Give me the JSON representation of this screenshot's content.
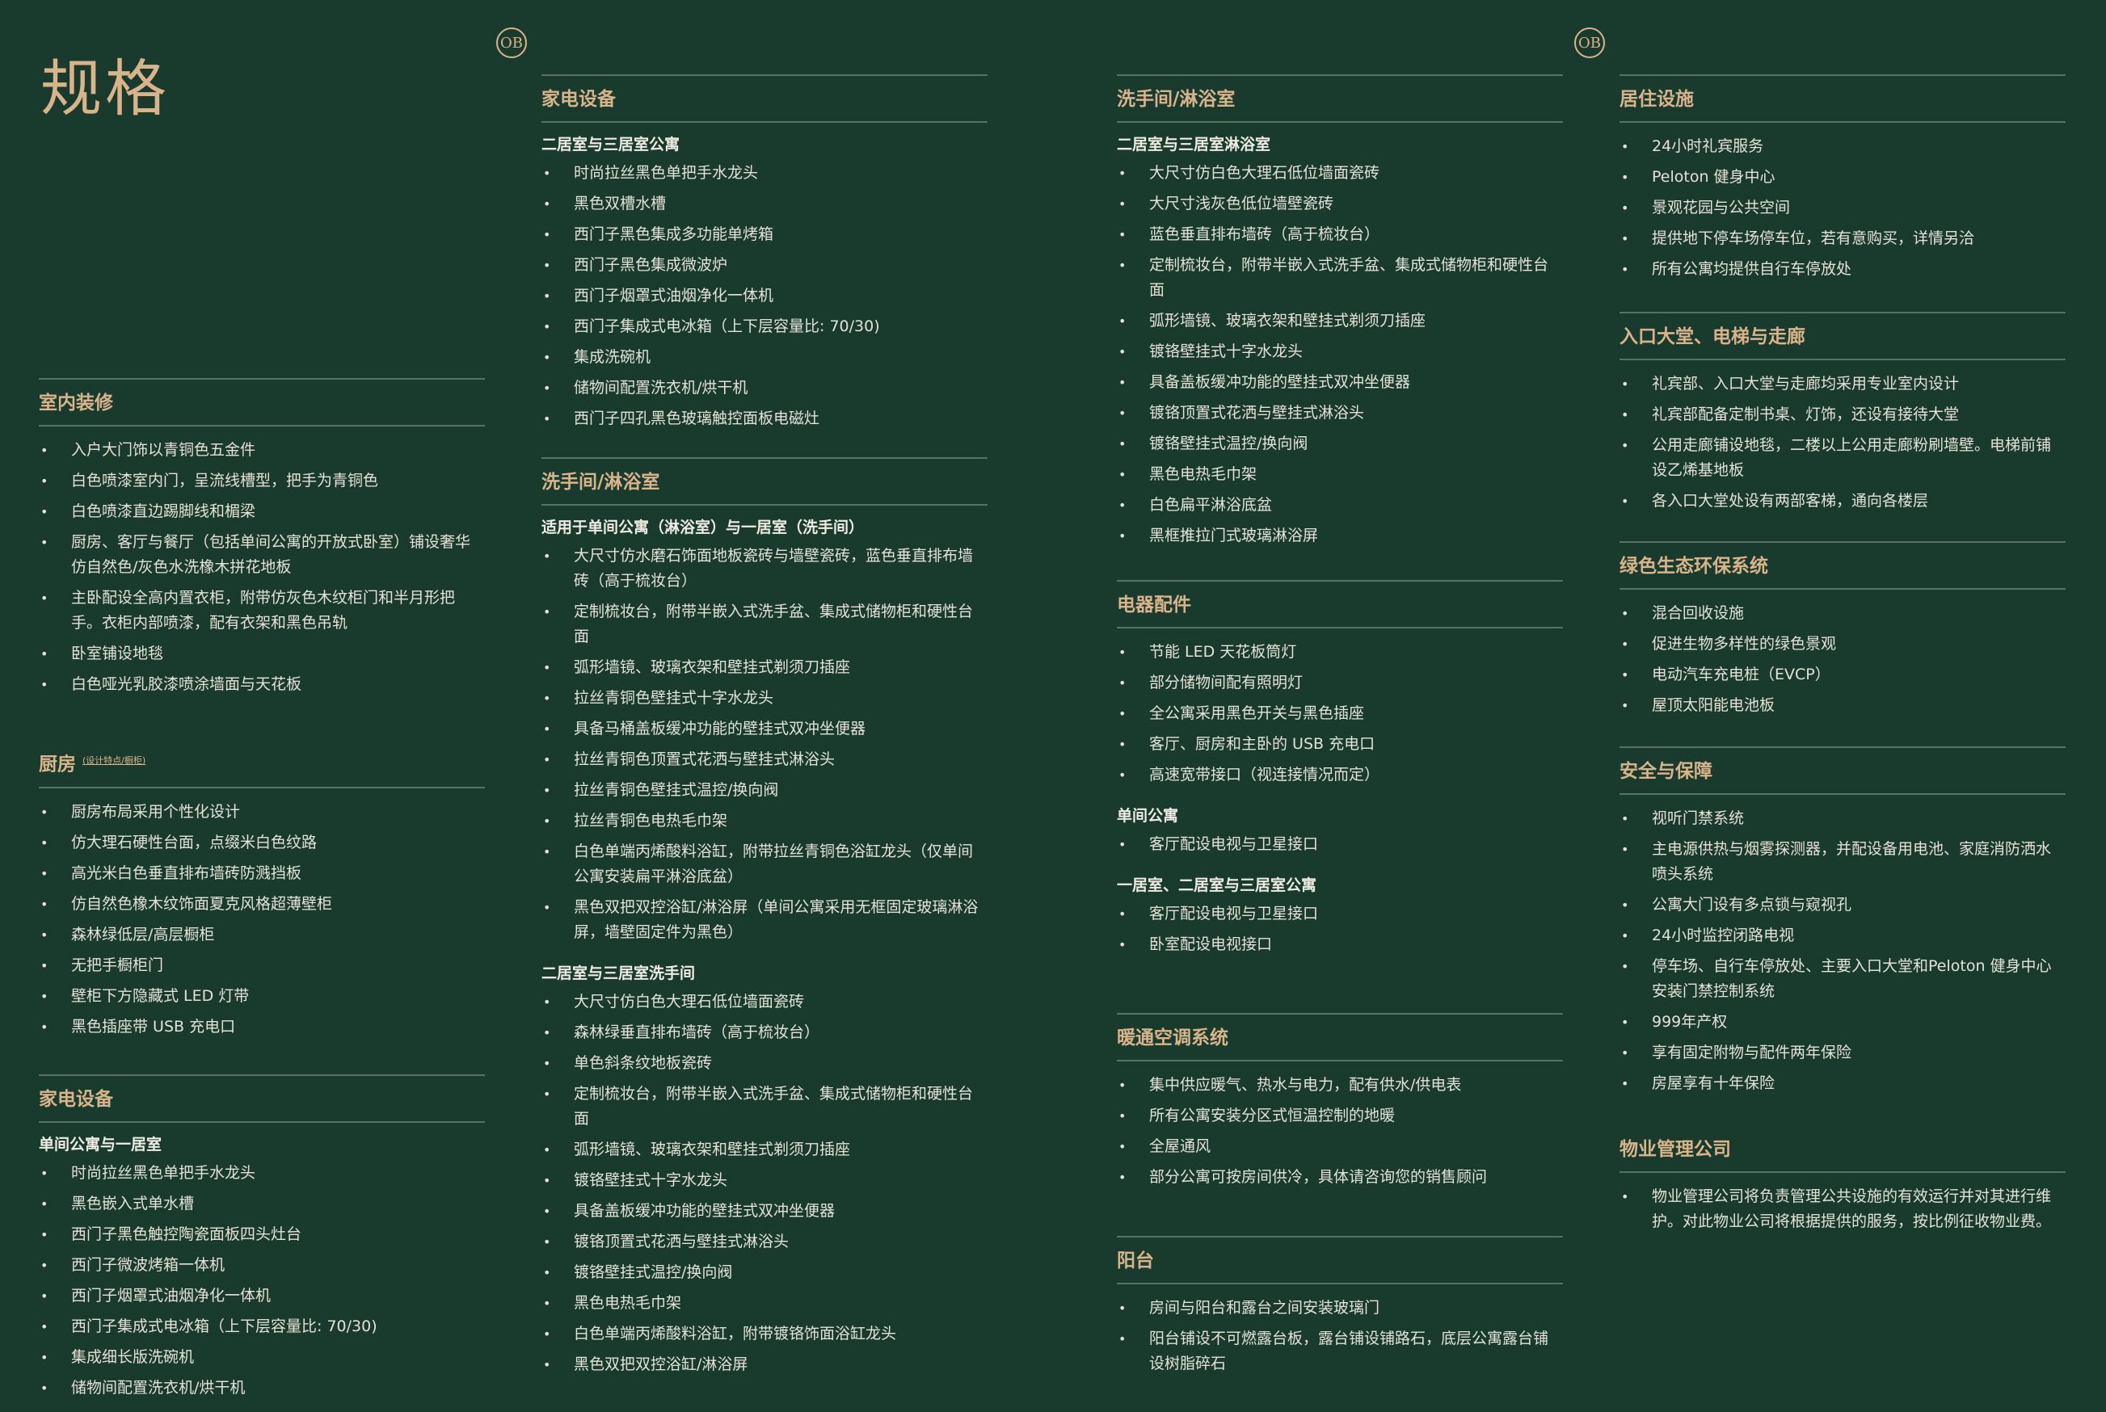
{
  "title": "规格",
  "logo_text": "OB",
  "col1": {
    "interior": {
      "title": "室内装修",
      "items": [
        "入户大门饰以青铜色五金件",
        "白色喷漆室内门，呈流线槽型，把手为青铜色",
        "白色喷漆直边踢脚线和楣梁",
        "厨房、客厅与餐厅（包括单间公寓的开放式卧室）铺设奢华仿自然色/灰色水洗橡木拼花地板",
        "主卧配设全高内置衣柜，附带仿灰色木纹柜门和半月形把手。衣柜内部喷漆，配有衣架和黑色吊轨",
        "卧室铺设地毯",
        "白色哑光乳胶漆喷涂墙面与天花板"
      ]
    },
    "kitchen": {
      "title": "厨房",
      "note": "(设计特点/橱柜)",
      "items": [
        "厨房布局采用个性化设计",
        "仿大理石硬性台面，点缀米白色纹路",
        "高光米白色垂直排布墙砖防溅挡板",
        "仿自然色橡木纹饰面夏克风格超薄壁柜",
        "森林绿低层/高层橱柜",
        "无把手橱柜门",
        "壁柜下方隐藏式 LED 灯带",
        "黑色插座带 USB 充电口"
      ]
    },
    "appliances": {
      "title": "家电设备",
      "sub": "单间公寓与一居室",
      "items": [
        "时尚拉丝黑色单把手水龙头",
        "黑色嵌入式单水槽",
        "西门子黑色触控陶瓷面板四头灶台",
        "西门子微波烤箱一体机",
        "西门子烟罩式油烟净化一体机",
        "西门子集成式电冰箱（上下层容量比: 70/30)",
        "集成细长版洗碗机",
        "储物间配置洗衣机/烘干机"
      ]
    }
  },
  "col2": {
    "appliances": {
      "title": "家电设备",
      "sub": "二居室与三居室公寓",
      "items": [
        "时尚拉丝黑色单把手水龙头",
        "黑色双槽水槽",
        "西门子黑色集成多功能单烤箱",
        "西门子黑色集成微波炉",
        "西门子烟罩式油烟净化一体机",
        "西门子集成式电冰箱（上下层容量比: 70/30)",
        "集成洗碗机",
        "储物间配置洗衣机/烘干机",
        "西门子四孔黑色玻璃触控面板电磁灶"
      ]
    },
    "bathroom": {
      "title": "洗手间/淋浴室",
      "sub1": "适用于单间公寓（淋浴室）与一居室（洗手间）",
      "items1": [
        "大尺寸仿水磨石饰面地板瓷砖与墙壁瓷砖，蓝色垂直排布墙砖（高于梳妆台）",
        "定制梳妆台，附带半嵌入式洗手盆、集成式储物柜和硬性台面",
        "弧形墙镜、玻璃衣架和壁挂式剃须刀插座",
        "拉丝青铜色壁挂式十字水龙头",
        "具备马桶盖板缓冲功能的壁挂式双冲坐便器",
        "拉丝青铜色顶置式花洒与壁挂式淋浴头",
        "拉丝青铜色壁挂式温控/换向阀",
        "拉丝青铜色电热毛巾架",
        "白色单端丙烯酸料浴缸，附带拉丝青铜色浴缸龙头（仅单间公寓安装扁平淋浴底盆）",
        "黑色双把双控浴缸/淋浴屏（单间公寓采用无框固定玻璃淋浴屏，墙壁固定件为黑色）"
      ],
      "sub2": "二居室与三居室洗手间",
      "items2": [
        "大尺寸仿白色大理石低位墙面瓷砖",
        "森林绿垂直排布墙砖（高于梳妆台）",
        "单色斜条纹地板瓷砖",
        "定制梳妆台，附带半嵌入式洗手盆、集成式储物柜和硬性台面",
        "弧形墙镜、玻璃衣架和壁挂式剃须刀插座",
        "镀铬壁挂式十字水龙头",
        "具备盖板缓冲功能的壁挂式双冲坐便器",
        "镀铬顶置式花洒与壁挂式淋浴头",
        "镀铬壁挂式温控/换向阀",
        "黑色电热毛巾架",
        "白色单端丙烯酸料浴缸，附带镀铬饰面浴缸龙头",
        "黑色双把双控浴缸/淋浴屏"
      ]
    }
  },
  "col3": {
    "bathroom": {
      "title": "洗手间/淋浴室",
      "sub": "二居室与三居室淋浴室",
      "items": [
        "大尺寸仿白色大理石低位墙面瓷砖",
        "大尺寸浅灰色低位墙壁瓷砖",
        "蓝色垂直排布墙砖（高于梳妆台）",
        "定制梳妆台，附带半嵌入式洗手盆、集成式储物柜和硬性台面",
        "弧形墙镜、玻璃衣架和壁挂式剃须刀插座",
        "镀铬壁挂式十字水龙头",
        "具备盖板缓冲功能的壁挂式双冲坐便器",
        "镀铬顶置式花洒与壁挂式淋浴头",
        "镀铬壁挂式温控/换向阀",
        "黑色电热毛巾架",
        "白色扁平淋浴底盆",
        "黑框推拉门式玻璃淋浴屏"
      ]
    },
    "electrical": {
      "title": "电器配件",
      "items": [
        "节能 LED 天花板筒灯",
        "部分储物间配有照明灯",
        "全公寓采用黑色开关与黑色插座",
        "客厅、厨房和主卧的 USB 充电口",
        "高速宽带接口（视连接情况而定）"
      ],
      "sub1": "单间公寓",
      "items1": [
        "客厅配设电视与卫星接口"
      ],
      "sub2": "一居室、二居室与三居室公寓",
      "items2": [
        "客厅配设电视与卫星接口",
        "卧室配设电视接口"
      ]
    },
    "hvac": {
      "title": "暖通空调系统",
      "items": [
        "集中供应暖气、热水与电力，配有供水/供电表",
        "所有公寓安装分区式恒温控制的地暖",
        "全屋通风",
        "部分公寓可按房间供冷，具体请咨询您的销售顾问"
      ]
    },
    "balcony": {
      "title": "阳台",
      "items": [
        "房间与阳台和露台之间安装玻璃门",
        "阳台铺设不可燃露台板，露台铺设铺路石，底层公寓露台铺设树脂碎石"
      ]
    }
  },
  "col4": {
    "residential": {
      "title": "居住设施",
      "items": [
        "24小时礼宾服务",
        "Peloton 健身中心",
        "景观花园与公共空间",
        "提供地下停车场停车位，若有意购买，详情另洽",
        "所有公寓均提供自行车停放处"
      ]
    },
    "lobby": {
      "title": "入口大堂、电梯与走廊",
      "items": [
        "礼宾部、入口大堂与走廊均采用专业室内设计",
        "礼宾部配备定制书桌、灯饰，还设有接待大堂",
        "公用走廊铺设地毯，二楼以上公用走廊粉刷墙壁。电梯前铺设乙烯基地板",
        "各入口大堂处设有两部客梯，通向各楼层"
      ]
    },
    "green": {
      "title": "绿色生态环保系统",
      "items": [
        "混合回收设施",
        "促进生物多样性的绿色景观",
        "电动汽车充电桩（EVCP）",
        "屋顶太阳能电池板"
      ]
    },
    "security": {
      "title": "安全与保障",
      "items": [
        "视听门禁系统",
        "主电源供热与烟雾探测器，并配设备用电池、家庭消防洒水喷头系统",
        "公寓大门设有多点锁与窥视孔",
        "24小时监控闭路电视",
        "停车场、自行车停放处、主要入口大堂和Peloton 健身中心安装门禁控制系统",
        "999年产权",
        "享有固定附物与配件两年保险",
        "房屋享有十年保险"
      ]
    },
    "management": {
      "title": "物业管理公司",
      "items": [
        "物业管理公司将负责管理公共设施的有效运行并对其进行维护。对此物业公司将根据提供的服务，按比例征收物业费。"
      ]
    }
  }
}
